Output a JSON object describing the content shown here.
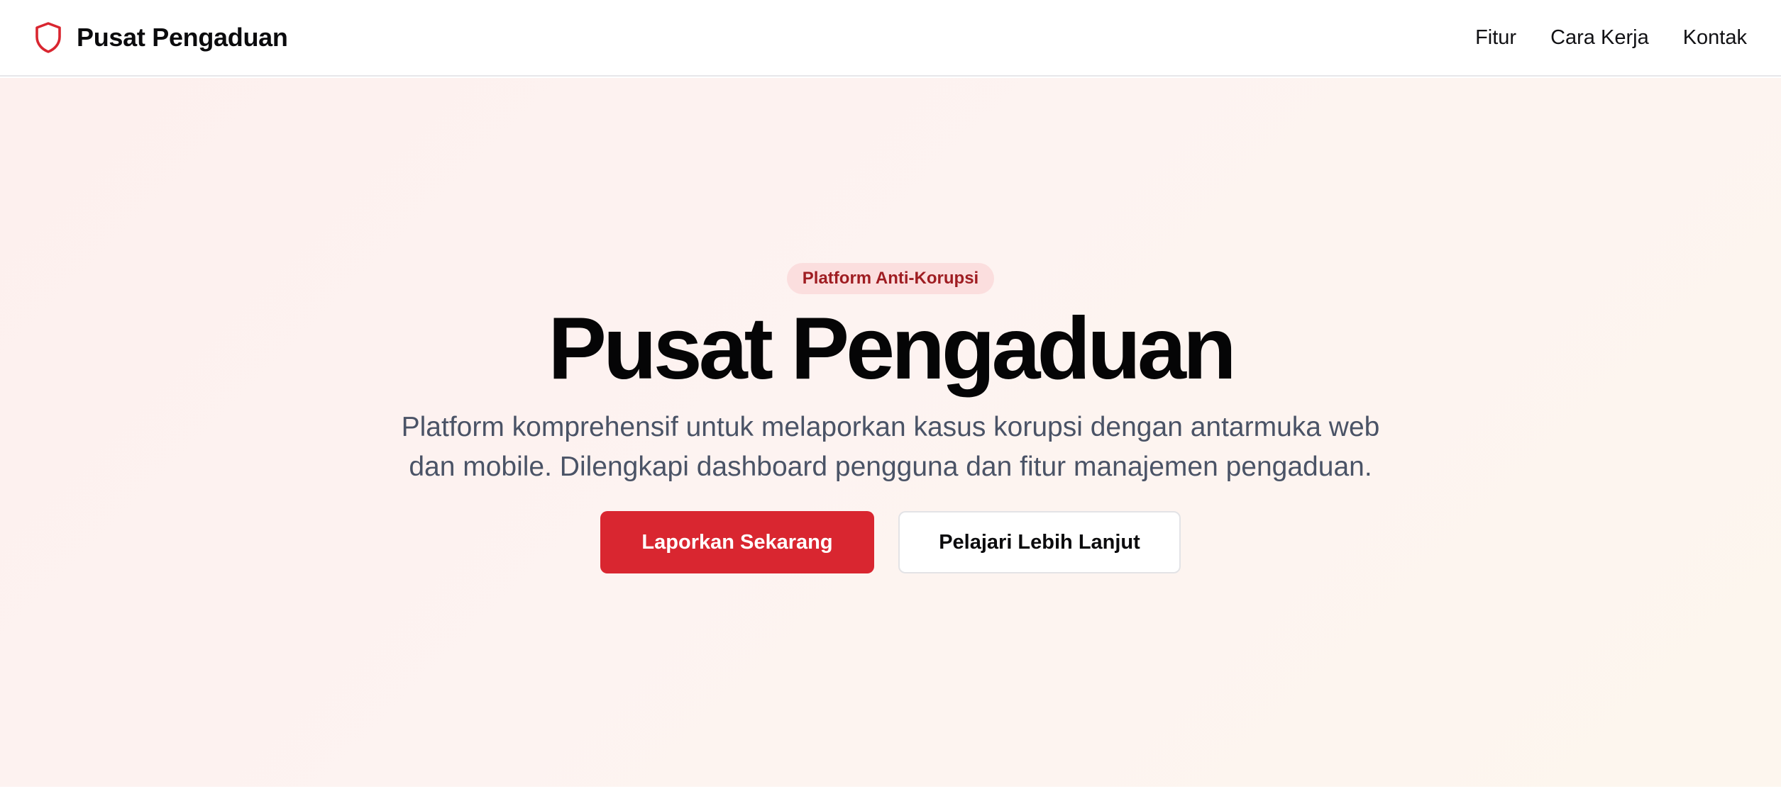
{
  "header": {
    "brand_icon": "shield-icon",
    "brand_name": "Pusat Pengaduan",
    "nav": [
      "Fitur",
      "Cara Kerja",
      "Kontak"
    ]
  },
  "hero": {
    "badge": "Platform Anti-Korupsi",
    "title": "Pusat Pengaduan",
    "description": "Platform komprehensif untuk melaporkan kasus korupsi dengan antarmuka web dan mobile. Dilengkapi dashboard pengguna dan fitur manajemen pengaduan.",
    "primary_button": "Laporkan Sekarang",
    "secondary_button": "Pelajari Lebih Lanjut"
  },
  "colors": {
    "accent": "#d92630",
    "badge_bg": "#fbdede",
    "badge_text": "#9f1d22",
    "hero_bg": "#fdf2ef",
    "description_text": "#4a5366"
  }
}
